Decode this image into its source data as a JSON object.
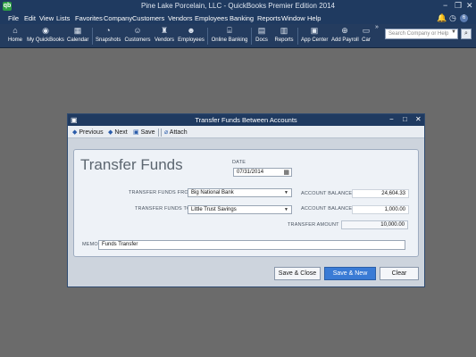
{
  "app": {
    "title": "Pine Lake Porcelain, LLC  -  QuickBooks Premier Edition 2014",
    "logo": "qb"
  },
  "menubar": {
    "items": [
      "File",
      "Edit",
      "View",
      "Lists",
      "Favorites",
      "Company",
      "Customers",
      "Vendors",
      "Employees",
      "Banking",
      "Reports",
      "Window",
      "Help"
    ],
    "notifications": "6"
  },
  "toolbar": {
    "items": [
      {
        "label": "Home",
        "icon": "home-icon"
      },
      {
        "label": "My QuickBooks",
        "icon": "quickbooks-icon"
      },
      {
        "label": "Calendar",
        "icon": "calendar-icon"
      },
      {
        "label": "Snapshots",
        "icon": "snapshots-icon"
      },
      {
        "label": "Customers",
        "icon": "customers-icon"
      },
      {
        "label": "Vendors",
        "icon": "vendors-icon"
      },
      {
        "label": "Employees",
        "icon": "employees-icon"
      },
      {
        "label": "Online Banking",
        "icon": "online-banking-icon"
      },
      {
        "label": "Docs",
        "icon": "docs-icon"
      },
      {
        "label": "Reports",
        "icon": "reports-icon"
      },
      {
        "label": "App Center",
        "icon": "app-center-icon"
      },
      {
        "label": "Add Payroll",
        "icon": "add-payroll-icon"
      },
      {
        "label": "Car",
        "icon": "car-icon"
      }
    ],
    "search_placeholder": "Search Company or Help"
  },
  "dialog": {
    "title": "Transfer Funds Between Accounts",
    "toolbar": {
      "previous": "Previous",
      "next": "Next",
      "save": "Save",
      "attach": "Attach"
    },
    "heading": "Transfer Funds",
    "date_label": "DATE",
    "date_value": "07/31/2014",
    "from_label": "TRANSFER FUNDS FROM",
    "from_value": "Big National Bank",
    "to_label": "TRANSFER FUNDS TO",
    "to_value": "Little Trust Savings",
    "balance_label_1": "ACCOUNT BALANCE",
    "balance_value_1": "24,604.33",
    "balance_label_2": "ACCOUNT BALANCE",
    "balance_value_2": "1,000.00",
    "amount_label": "TRANSFER AMOUNT",
    "amount_value": "10,000.00",
    "memo_label": "MEMO",
    "memo_value": "Funds Transfer",
    "buttons": {
      "save_close": "Save & Close",
      "save_new": "Save & New",
      "clear": "Clear"
    }
  }
}
